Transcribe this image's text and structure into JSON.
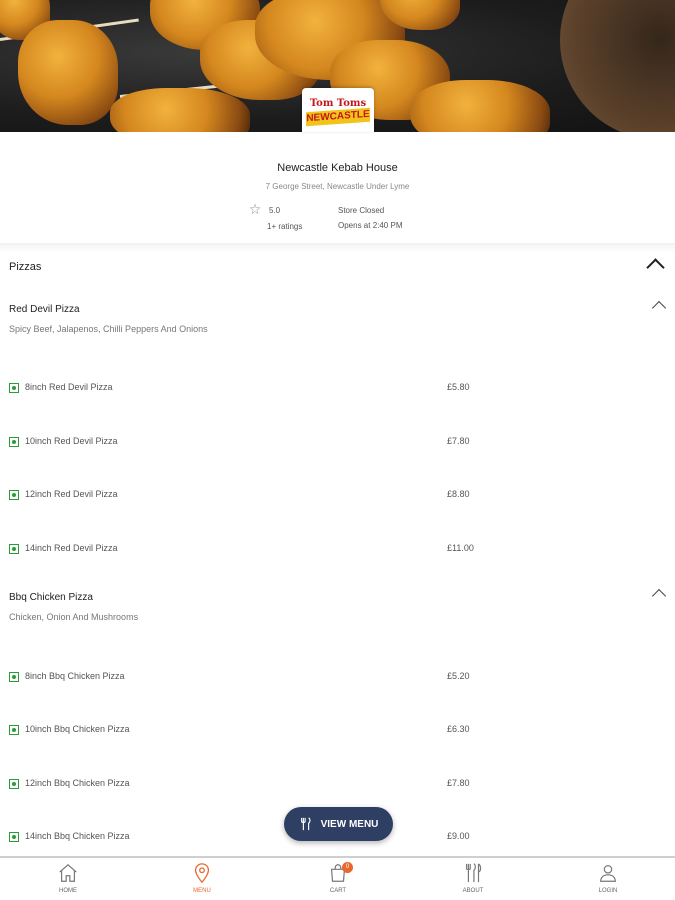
{
  "store": {
    "name": "Newcastle Kebab House",
    "address": "7 George Street, Newcastle Under Lyme",
    "rating": "5.0",
    "rating_count": "1+ ratings",
    "status": "Store Closed",
    "opens": "Opens at 2:40 PM",
    "logo_top": "Tom Toms",
    "logo_band": "NEWCASTLE"
  },
  "section": {
    "title": "Pizzas"
  },
  "groups": [
    {
      "title": "Red Devil Pizza",
      "description": "Spicy Beef, Jalapenos, Chilli Peppers And Onions",
      "items": [
        {
          "name": "8inch Red Devil Pizza",
          "price": "£5.80"
        },
        {
          "name": "10inch Red Devil Pizza",
          "price": "£7.80"
        },
        {
          "name": "12inch Red Devil Pizza",
          "price": "£8.80"
        },
        {
          "name": "14inch Red Devil Pizza",
          "price": "£11.00"
        }
      ]
    },
    {
      "title": "Bbq Chicken Pizza",
      "description": "Chicken, Onion And Mushrooms",
      "items": [
        {
          "name": "8inch Bbq Chicken Pizza",
          "price": "£5.20"
        },
        {
          "name": "10inch Bbq Chicken Pizza",
          "price": "£6.30"
        },
        {
          "name": "12inch Bbq Chicken Pizza",
          "price": "£7.80"
        },
        {
          "name": "14inch Bbq Chicken Pizza",
          "price": "£9.00"
        }
      ]
    }
  ],
  "view_menu": {
    "label": "VIEW MENU"
  },
  "tabbar": {
    "cart_count": "0",
    "tabs": [
      {
        "label": "HOME",
        "icon": "home-icon"
      },
      {
        "label": "MENU",
        "icon": "location-pin-icon"
      },
      {
        "label": "CART",
        "icon": "shopping-bag-icon"
      },
      {
        "label": "ABOUT",
        "icon": "cutlery-icon"
      },
      {
        "label": "LOGIN",
        "icon": "user-icon"
      }
    ]
  },
  "colors": {
    "accent": "#e8672c",
    "button": "#2e3f63",
    "veg": "#2a9d3a"
  }
}
